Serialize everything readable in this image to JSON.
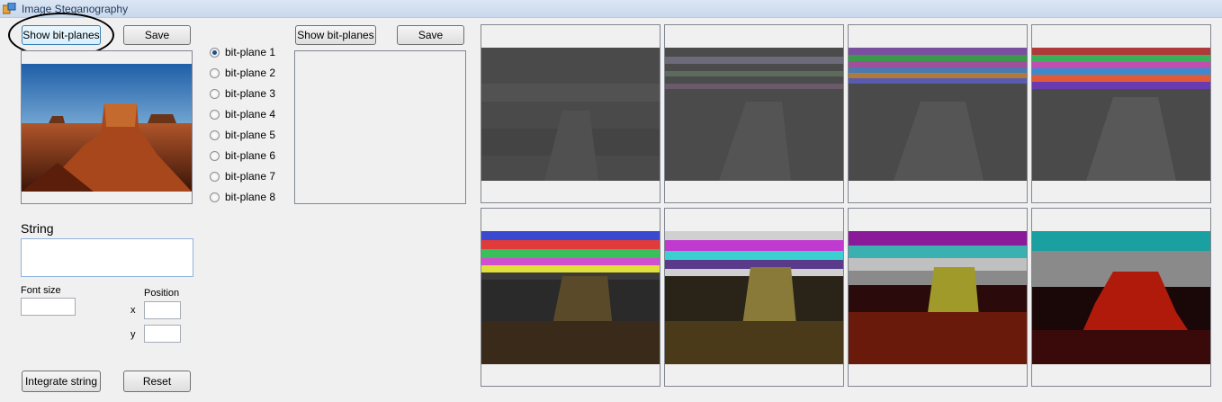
{
  "window": {
    "title": "Image Steganography"
  },
  "left": {
    "show_bitplanes_label": "Show bit-planes",
    "save_label": "Save",
    "string_label": "String",
    "string_value": "",
    "font_size_label": "Font size",
    "font_size_value": "",
    "position_label": "Position",
    "x_label": "x",
    "y_label": "y",
    "x_value": "",
    "y_value": "",
    "integrate_label": "Integrate string",
    "reset_label": "Reset"
  },
  "bitplanes": {
    "options": [
      "bit-plane 1",
      "bit-plane 2",
      "bit-plane 3",
      "bit-plane 4",
      "bit-plane 5",
      "bit-plane 6",
      "bit-plane 7",
      "bit-plane 8"
    ],
    "selected_index": 0
  },
  "middle": {
    "show_bitplanes_label": "Show bit-planes",
    "save_label": "Save"
  }
}
